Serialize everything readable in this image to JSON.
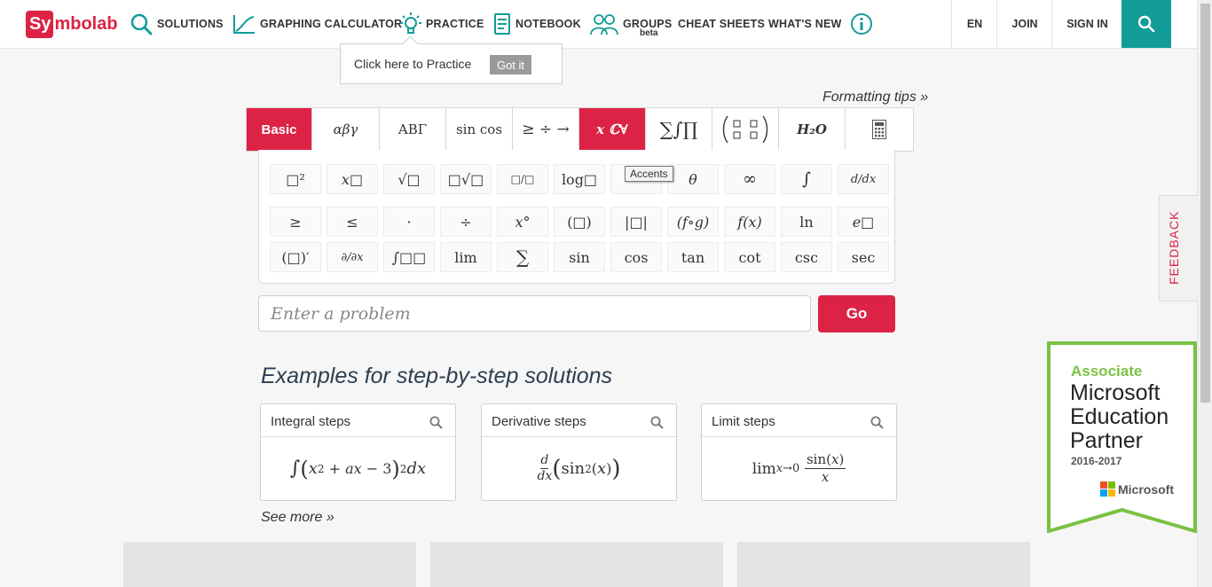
{
  "nav": {
    "logo_part1": "Sy",
    "logo_part2": "mbolab",
    "solutions": "SOLUTIONS",
    "graphing": "GRAPHING CALCULATOR",
    "practice": "PRACTICE",
    "notebook": "NOTEBOOK",
    "groups": "GROUPS",
    "groups_badge": "beta",
    "cheat_sheets": "CHEAT SHEETS",
    "whats_new": "WHAT'S NEW",
    "lang": "EN",
    "join": "JOIN",
    "sign_in": "SIGN IN",
    "accent_color": "#dc2345",
    "search_color": "#129c97"
  },
  "practice_popup": {
    "text": "Click here to Practice",
    "button": "Got it"
  },
  "keyboard": {
    "formatting_tips": "Formatting tips »",
    "tabs": [
      {
        "label": "Basic",
        "active": true
      },
      {
        "label": "αβγ",
        "active": false
      },
      {
        "label": "ΑΒΓ",
        "active": false
      },
      {
        "label": "sin cos",
        "active": false
      },
      {
        "label": "≥ ÷ →",
        "active": false
      },
      {
        "label": "x ℂ∀",
        "active": true
      },
      {
        "label": "∑∫∏",
        "active": false
      },
      {
        "label": "matrix",
        "active": false
      },
      {
        "label": "H₂O",
        "active": false
      },
      {
        "label": "calculator-icon",
        "active": false
      }
    ],
    "rows": [
      [
        "□²",
        "x□",
        "√□",
        "□√□",
        "□/□",
        "log□",
        "accents",
        "θ",
        "∞",
        "∫",
        "d/dx"
      ],
      [
        "≥",
        "≤",
        "·",
        "÷",
        "x°",
        "(□)",
        "|□|",
        "(f∘g)",
        "f(x)",
        "ln",
        "e□"
      ],
      [
        "(□)′",
        "∂/∂x",
        "∫□□",
        "lim",
        "∑",
        "sin",
        "cos",
        "tan",
        "cot",
        "csc",
        "sec"
      ]
    ],
    "tooltip": "Accents"
  },
  "search": {
    "placeholder": "Enter a problem",
    "go": "Go"
  },
  "examples": {
    "title": "Examples for step-by-step solutions",
    "cards": [
      {
        "title": "Integral steps",
        "formula": "integral"
      },
      {
        "title": "Derivative steps",
        "formula": "derivative"
      },
      {
        "title": "Limit steps",
        "formula": "limit"
      }
    ],
    "see_more": "See more »"
  },
  "feedback": "FEEDBACK",
  "badge": {
    "associate": "Associate",
    "line1": "Microsoft",
    "line2": "Education",
    "line3": "Partner",
    "years": "2016-2017",
    "brand": "Microsoft",
    "border_color": "#7ac143"
  }
}
